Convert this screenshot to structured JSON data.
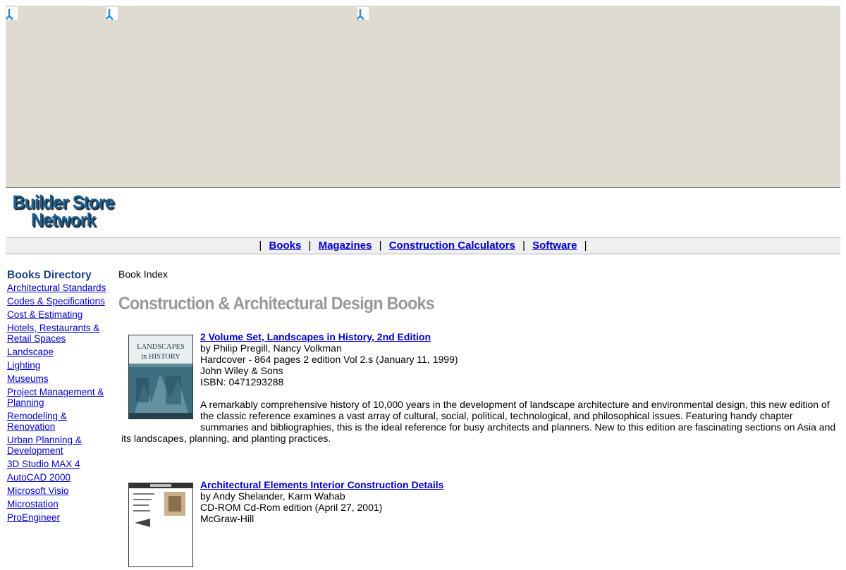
{
  "header": {
    "logo_line1": "Builder Store",
    "logo_line2": "Network"
  },
  "nav": {
    "separator": "|",
    "items": [
      {
        "label": "Books"
      },
      {
        "label": "Magazines"
      },
      {
        "label": "Construction Calculators"
      },
      {
        "label": "Software"
      }
    ]
  },
  "sidebar": {
    "title": "Books Directory",
    "items": [
      "Architectural Standards",
      "Codes & Specifications",
      "Cost & Estimating",
      "Hotels, Restaurants & Retail Spaces",
      "Landscape",
      "Lighting",
      "Museums",
      "Project Management & Planning",
      "Remodeling & Renovation",
      "Urban Planning & Development",
      "3D Studio MAX 4",
      "AutoCAD 2000",
      "Microsoft Visio",
      "Microstation",
      "ProEngineer"
    ]
  },
  "main": {
    "breadcrumb": "Book Index",
    "title": "Construction & Architectural Design Books",
    "books": [
      {
        "title": "2 Volume Set, Landscapes in History, 2nd Edition",
        "authors": "by Philip Pregill, Nancy Volkman",
        "format": "Hardcover - 864 pages 2 edition Vol 2.s (January 11, 1999)",
        "publisher": "John Wiley & Sons",
        "isbn": "ISBN: 0471293288",
        "description": "A remarkably comprehensive history of 10,000 years in the development of landscape architecture and environmental design, this new edition of the classic reference examines a vast array of cultural, social, political, technological, and philosophical issues. Featuring handy chapter summaries and bibliographies, this is the ideal reference for busy architects and planners. New to this edition are fascinating sections on Asia and its landscapes, planning, and planting practices.",
        "cover_text_line1": "LANDSCAPES",
        "cover_text_line2": "in HISTORY"
      },
      {
        "title": "Architectural Elements Interior Construction Details",
        "authors": "by Andy Shelander, Karm Wahab",
        "format": "CD-ROM Cd-Rom edition (April 27, 2001)",
        "publisher": "McGraw-Hill"
      }
    ]
  },
  "colors": {
    "banner_bg": "#dfdbd0",
    "logo_blue": "#1b5f93",
    "link": "#0000cc",
    "title_grey": "#999999"
  }
}
